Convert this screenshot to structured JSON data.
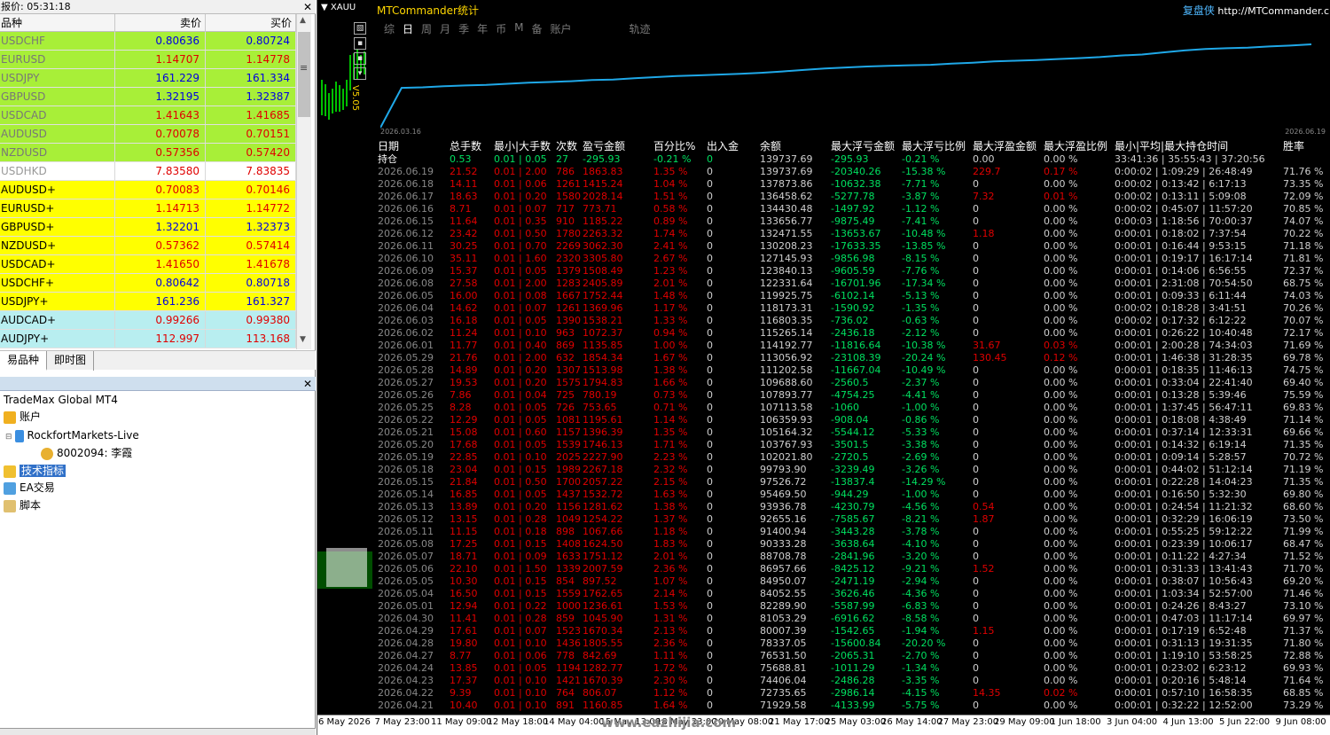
{
  "market_watch": {
    "title": "报价: 05:31:18",
    "headers": {
      "symbol": "品种",
      "bid": "卖价",
      "ask": "买价"
    },
    "rows": [
      {
        "symbol": "USDCHF",
        "bid": "0.80636",
        "ask": "0.80724",
        "bg": "#a8ef38",
        "sym_color": "#777777",
        "val_color": "#0000e0"
      },
      {
        "symbol": "EURUSD",
        "bid": "1.14707",
        "ask": "1.14778",
        "bg": "#a8ef38",
        "sym_color": "#777777",
        "val_color": "#e00000"
      },
      {
        "symbol": "USDJPY",
        "bid": "161.229",
        "ask": "161.334",
        "bg": "#a8ef38",
        "sym_color": "#777777",
        "val_color": "#0000e0"
      },
      {
        "symbol": "GBPUSD",
        "bid": "1.32195",
        "ask": "1.32387",
        "bg": "#a8ef38",
        "sym_color": "#777777",
        "val_color": "#0000e0"
      },
      {
        "symbol": "USDCAD",
        "bid": "1.41643",
        "ask": "1.41685",
        "bg": "#a8ef38",
        "sym_color": "#777777",
        "val_color": "#e00000"
      },
      {
        "symbol": "AUDUSD",
        "bid": "0.70078",
        "ask": "0.70151",
        "bg": "#a8ef38",
        "sym_color": "#777777",
        "val_color": "#e00000"
      },
      {
        "symbol": "NZDUSD",
        "bid": "0.57356",
        "ask": "0.57420",
        "bg": "#a8ef38",
        "sym_color": "#777777",
        "val_color": "#e00000"
      },
      {
        "symbol": "USDHKD",
        "bid": "7.83580",
        "ask": "7.83835",
        "bg": "#ffffff",
        "sym_color": "#999999",
        "val_color": "#e00000"
      },
      {
        "symbol": "AUDUSD+",
        "bid": "0.70083",
        "ask": "0.70146",
        "bg": "#ffff00",
        "sym_color": "#000000",
        "val_color": "#e00000"
      },
      {
        "symbol": "EURUSD+",
        "bid": "1.14713",
        "ask": "1.14772",
        "bg": "#ffff00",
        "sym_color": "#000000",
        "val_color": "#e00000"
      },
      {
        "symbol": "GBPUSD+",
        "bid": "1.32201",
        "ask": "1.32373",
        "bg": "#ffff00",
        "sym_color": "#000000",
        "val_color": "#0000e0"
      },
      {
        "symbol": "NZDUSD+",
        "bid": "0.57362",
        "ask": "0.57414",
        "bg": "#ffff00",
        "sym_color": "#000000",
        "val_color": "#e00000"
      },
      {
        "symbol": "USDCAD+",
        "bid": "1.41650",
        "ask": "1.41678",
        "bg": "#ffff00",
        "sym_color": "#000000",
        "val_color": "#e00000"
      },
      {
        "symbol": "USDCHF+",
        "bid": "0.80642",
        "ask": "0.80718",
        "bg": "#ffff00",
        "sym_color": "#000000",
        "val_color": "#0000e0"
      },
      {
        "symbol": "USDJPY+",
        "bid": "161.236",
        "ask": "161.327",
        "bg": "#ffff00",
        "sym_color": "#000000",
        "val_color": "#0000e0"
      },
      {
        "symbol": "AUDCAD+",
        "bid": "0.99266",
        "ask": "0.99380",
        "bg": "#b8eef0",
        "sym_color": "#000000",
        "val_color": "#e00000"
      },
      {
        "symbol": "AUDJPY+",
        "bid": "112.997",
        "ask": "113.168",
        "bg": "#b8eef0",
        "sym_color": "#000000",
        "val_color": "#e00000"
      }
    ],
    "tabs": [
      "易品种",
      "即时图"
    ]
  },
  "navigator": {
    "title": "",
    "broker": "TradeMax Global MT4",
    "accounts_label": "账户",
    "server": "RockfortMarkets-Live",
    "account": "8002094: 李霞",
    "indicators_label": "技术指标",
    "ea_label": "EA交易",
    "scripts_label": "脚本"
  },
  "chart": {
    "symbol": "XAUU",
    "side_label": "V5.05",
    "watermark": "www.eazhijia.com",
    "axis_ticks": [
      "6 May 2026",
      "7 May 23:00",
      "11 May 09:00",
      "12 May 18:00",
      "14 May 04:00",
      "15 May 13:00",
      "18 May 23:00",
      "20 May 08:00",
      "21 May 17:00",
      "25 May 03:00",
      "26 May 14:00",
      "27 May 23:00",
      "29 May 09:00",
      "1 Jun 18:00",
      "3 Jun 04:00",
      "4 Jun 13:00",
      "5 Jun 22:00",
      "9 Jun 08:00"
    ]
  },
  "panel": {
    "title": "MTCommander统计",
    "brand_cn": "复盘侠",
    "brand_url": "http://MTCommander.c",
    "tabs": [
      "综",
      "日",
      "周",
      "月",
      "季",
      "年",
      "币",
      "M",
      "备",
      "账户",
      "轨迹"
    ],
    "selected_tab": "日",
    "curve_start": "2026.03.16",
    "curve_end": "2026.06.19",
    "columns": [
      "日期",
      "总手数",
      "最小|大手数",
      "次数",
      "盈亏金额",
      "百分比%",
      "出入金",
      "余额",
      "最大浮亏金额",
      "最大浮亏比例",
      "最大浮盈金额",
      "最大浮盈比例",
      "最小|平均|最大持仓时间",
      "胜率"
    ],
    "holding_row": [
      "持仓",
      "0.53",
      "0.01 | 0.05",
      "27",
      "-295.93",
      "-0.21 %",
      "0",
      "139737.69",
      "-295.93",
      "-0.21 %",
      "0.00",
      "0.00 %",
      "33:41:36 | 35:55:43 | 37:20:56",
      ""
    ],
    "rows": [
      [
        "2026.06.19",
        "21.52",
        "0.01 | 2.00",
        "786",
        "1863.83",
        "1.35 %",
        "0",
        "139737.69",
        "-20340.26",
        "-15.38 %",
        "229.7",
        "0.17 %",
        "0:00:02 | 1:09:29 | 26:48:49",
        "71.76 %"
      ],
      [
        "2026.06.18",
        "14.11",
        "0.01 | 0.06",
        "1261",
        "1415.24",
        "1.04 %",
        "0",
        "137873.86",
        "-10632.38",
        "-7.71 %",
        "0",
        "0.00 %",
        "0:00:02 | 0:13:42 | 6:17:13",
        "73.35 %"
      ],
      [
        "2026.06.17",
        "18.63",
        "0.01 | 0.20",
        "1580",
        "2028.14",
        "1.51 %",
        "0",
        "136458.62",
        "-5277.78",
        "-3.87 %",
        "7.32",
        "0.01 %",
        "0:00:02 | 0:13:11 | 5:09:08",
        "72.09 %"
      ],
      [
        "2026.06.16",
        "8.71",
        "0.01 | 0.07",
        "717",
        "773.71",
        "0.58 %",
        "0",
        "134430.48",
        "-1497.92",
        "-1.12 %",
        "0",
        "0.00 %",
        "0:00:02 | 0:45:07 | 11:57:20",
        "70.85 %"
      ],
      [
        "2026.06.15",
        "11.64",
        "0.01 | 0.35",
        "910",
        "1185.22",
        "0.89 %",
        "0",
        "133656.77",
        "-9875.49",
        "-7.41 %",
        "0",
        "0.00 %",
        "0:00:03 | 1:18:56 | 70:00:37",
        "74.07 %"
      ],
      [
        "2026.06.12",
        "23.42",
        "0.01 | 0.50",
        "1780",
        "2263.32",
        "1.74 %",
        "0",
        "132471.55",
        "-13653.67",
        "-10.48 %",
        "1.18",
        "0.00 %",
        "0:00:01 | 0:18:02 | 7:37:54",
        "70.22 %"
      ],
      [
        "2026.06.11",
        "30.25",
        "0.01 | 0.70",
        "2269",
        "3062.30",
        "2.41 %",
        "0",
        "130208.23",
        "-17633.35",
        "-13.85 %",
        "0",
        "0.00 %",
        "0:00:01 | 0:16:44 | 9:53:15",
        "71.18 %"
      ],
      [
        "2026.06.10",
        "35.11",
        "0.01 | 1.60",
        "2320",
        "3305.80",
        "2.67 %",
        "0",
        "127145.93",
        "-9856.98",
        "-8.15 %",
        "0",
        "0.00 %",
        "0:00:01 | 0:19:17 | 16:17:14",
        "71.81 %"
      ],
      [
        "2026.06.09",
        "15.37",
        "0.01 | 0.05",
        "1379",
        "1508.49",
        "1.23 %",
        "0",
        "123840.13",
        "-9605.59",
        "-7.76 %",
        "0",
        "0.00 %",
        "0:00:01 | 0:14:06 | 6:56:55",
        "72.37 %"
      ],
      [
        "2026.06.08",
        "27.58",
        "0.01 | 2.00",
        "1283",
        "2405.89",
        "2.01 %",
        "0",
        "122331.64",
        "-16701.96",
        "-17.34 %",
        "0",
        "0.00 %",
        "0:00:01 | 2:31:08 | 70:54:50",
        "68.75 %"
      ],
      [
        "2026.06.05",
        "16.00",
        "0.01 | 0.08",
        "1667",
        "1752.44",
        "1.48 %",
        "0",
        "119925.75",
        "-6102.14",
        "-5.13 %",
        "0",
        "0.00 %",
        "0:00:01 | 0:09:33 | 6:11:44",
        "74.03 %"
      ],
      [
        "2026.06.04",
        "14.62",
        "0.01 | 0.07",
        "1261",
        "1369.96",
        "1.17 %",
        "0",
        "118173.31",
        "-1590.92",
        "-1.35 %",
        "0",
        "0.00 %",
        "0:00:02 | 0:18:28 | 3:41:51",
        "70.26 %"
      ],
      [
        "2026.06.03",
        "16.18",
        "0.01 | 0.05",
        "1390",
        "1538.21",
        "1.33 %",
        "0",
        "116803.35",
        "-736.02",
        "-0.63 %",
        "0",
        "0.00 %",
        "0:00:02 | 0:17:32 | 6:12:22",
        "70.07 %"
      ],
      [
        "2026.06.02",
        "11.24",
        "0.01 | 0.10",
        "963",
        "1072.37",
        "0.94 %",
        "0",
        "115265.14",
        "-2436.18",
        "-2.12 %",
        "0",
        "0.00 %",
        "0:00:01 | 0:26:22 | 10:40:48",
        "72.17 %"
      ],
      [
        "2026.06.01",
        "11.77",
        "0.01 | 0.40",
        "869",
        "1135.85",
        "1.00 %",
        "0",
        "114192.77",
        "-11816.64",
        "-10.38 %",
        "31.67",
        "0.03 %",
        "0:00:01 | 2:00:28 | 74:34:03",
        "71.69 %"
      ],
      [
        "2026.05.29",
        "21.76",
        "0.01 | 2.00",
        "632",
        "1854.34",
        "1.67 %",
        "0",
        "113056.92",
        "-23108.39",
        "-20.24 %",
        "130.45",
        "0.12 %",
        "0:00:01 | 1:46:38 | 31:28:35",
        "69.78 %"
      ],
      [
        "2026.05.28",
        "14.89",
        "0.01 | 0.20",
        "1307",
        "1513.98",
        "1.38 %",
        "0",
        "111202.58",
        "-11667.04",
        "-10.49 %",
        "0",
        "0.00 %",
        "0:00:01 | 0:18:35 | 11:46:13",
        "74.75 %"
      ],
      [
        "2026.05.27",
        "19.53",
        "0.01 | 0.20",
        "1575",
        "1794.83",
        "1.66 %",
        "0",
        "109688.60",
        "-2560.5",
        "-2.37 %",
        "0",
        "0.00 %",
        "0:00:01 | 0:33:04 | 22:41:40",
        "69.40 %"
      ],
      [
        "2026.05.26",
        "7.86",
        "0.01 | 0.04",
        "725",
        "780.19",
        "0.73 %",
        "0",
        "107893.77",
        "-4754.25",
        "-4.41 %",
        "0",
        "0.00 %",
        "0:00:01 | 0:13:28 | 5:39:46",
        "75.59 %"
      ],
      [
        "2026.05.25",
        "8.28",
        "0.01 | 0.05",
        "726",
        "753.65",
        "0.71 %",
        "0",
        "107113.58",
        "-1060",
        "-1.00 %",
        "0",
        "0.00 %",
        "0:00:01 | 1:37:45 | 56:47:11",
        "69.83 %"
      ],
      [
        "2026.05.22",
        "12.29",
        "0.01 | 0.05",
        "1081",
        "1195.61",
        "1.14 %",
        "0",
        "106359.93",
        "-908.04",
        "-0.86 %",
        "0",
        "0.00 %",
        "0:00:01 | 0:18:08 | 4:38:49",
        "71.14 %"
      ],
      [
        "2026.05.21",
        "15.08",
        "0.01 | 0.60",
        "1157",
        "1396.39",
        "1.35 %",
        "0",
        "105164.32",
        "-5544.12",
        "-5.33 %",
        "0",
        "0.00 %",
        "0:00:01 | 0:37:14 | 12:33:31",
        "69.66 %"
      ],
      [
        "2026.05.20",
        "17.68",
        "0.01 | 0.05",
        "1539",
        "1746.13",
        "1.71 %",
        "0",
        "103767.93",
        "-3501.5",
        "-3.38 %",
        "0",
        "0.00 %",
        "0:00:01 | 0:14:32 | 6:19:14",
        "71.35 %"
      ],
      [
        "2026.05.19",
        "22.85",
        "0.01 | 0.10",
        "2025",
        "2227.90",
        "2.23 %",
        "0",
        "102021.80",
        "-2720.5",
        "-2.69 %",
        "0",
        "0.00 %",
        "0:00:01 | 0:09:14 | 5:28:57",
        "70.72 %"
      ],
      [
        "2026.05.18",
        "23.04",
        "0.01 | 0.15",
        "1989",
        "2267.18",
        "2.32 %",
        "0",
        "99793.90",
        "-3239.49",
        "-3.26 %",
        "0",
        "0.00 %",
        "0:00:01 | 0:44:02 | 51:12:14",
        "71.19 %"
      ],
      [
        "2026.05.15",
        "21.84",
        "0.01 | 0.50",
        "1700",
        "2057.22",
        "2.15 %",
        "0",
        "97526.72",
        "-13837.4",
        "-14.29 %",
        "0",
        "0.00 %",
        "0:00:01 | 0:22:28 | 14:04:23",
        "71.35 %"
      ],
      [
        "2026.05.14",
        "16.85",
        "0.01 | 0.05",
        "1437",
        "1532.72",
        "1.63 %",
        "0",
        "95469.50",
        "-944.29",
        "-1.00 %",
        "0",
        "0.00 %",
        "0:00:01 | 0:16:50 | 5:32:30",
        "69.80 %"
      ],
      [
        "2026.05.13",
        "13.89",
        "0.01 | 0.20",
        "1156",
        "1281.62",
        "1.38 %",
        "0",
        "93936.78",
        "-4230.79",
        "-4.56 %",
        "0.54",
        "0.00 %",
        "0:00:01 | 0:24:54 | 11:21:32",
        "68.60 %"
      ],
      [
        "2026.05.12",
        "13.15",
        "0.01 | 0.28",
        "1049",
        "1254.22",
        "1.37 %",
        "0",
        "92655.16",
        "-7585.67",
        "-8.21 %",
        "1.87",
        "0.00 %",
        "0:00:01 | 0:32:29 | 16:06:19",
        "73.50 %"
      ],
      [
        "2026.05.11",
        "11.15",
        "0.01 | 0.18",
        "898",
        "1067.66",
        "1.18 %",
        "0",
        "91400.94",
        "-3443.28",
        "-3.78 %",
        "0",
        "0.00 %",
        "0:00:01 | 0:55:25 | 59:12:22",
        "71.99 %"
      ],
      [
        "2026.05.08",
        "17.25",
        "0.01 | 0.15",
        "1408",
        "1624.50",
        "1.83 %",
        "0",
        "90333.28",
        "-3638.64",
        "-4.10 %",
        "0",
        "0.00 %",
        "0:00:01 | 0:23:39 | 10:06:17",
        "68.47 %"
      ],
      [
        "2026.05.07",
        "18.71",
        "0.01 | 0.09",
        "1633",
        "1751.12",
        "2.01 %",
        "0",
        "88708.78",
        "-2841.96",
        "-3.20 %",
        "0",
        "0.00 %",
        "0:00:01 | 0:11:22 | 4:27:34",
        "71.52 %"
      ],
      [
        "2026.05.06",
        "22.10",
        "0.01 | 1.50",
        "1339",
        "2007.59",
        "2.36 %",
        "0",
        "86957.66",
        "-8425.12",
        "-9.21 %",
        "1.52",
        "0.00 %",
        "0:00:01 | 0:31:33 | 13:41:43",
        "71.70 %"
      ],
      [
        "2026.05.05",
        "10.30",
        "0.01 | 0.15",
        "854",
        "897.52",
        "1.07 %",
        "0",
        "84950.07",
        "-2471.19",
        "-2.94 %",
        "0",
        "0.00 %",
        "0:00:01 | 0:38:07 | 10:56:43",
        "69.20 %"
      ],
      [
        "2026.05.04",
        "16.50",
        "0.01 | 0.15",
        "1559",
        "1762.65",
        "2.14 %",
        "0",
        "84052.55",
        "-3626.46",
        "-4.36 %",
        "0",
        "0.00 %",
        "0:00:01 | 1:03:34 | 52:57:00",
        "71.46 %"
      ],
      [
        "2026.05.01",
        "12.94",
        "0.01 | 0.22",
        "1000",
        "1236.61",
        "1.53 %",
        "0",
        "82289.90",
        "-5587.99",
        "-6.83 %",
        "0",
        "0.00 %",
        "0:00:01 | 0:24:26 | 8:43:27",
        "73.10 %"
      ],
      [
        "2026.04.30",
        "11.41",
        "0.01 | 0.28",
        "859",
        "1045.90",
        "1.31 %",
        "0",
        "81053.29",
        "-6916.62",
        "-8.58 %",
        "0",
        "0.00 %",
        "0:00:01 | 0:47:03 | 11:17:14",
        "69.97 %"
      ],
      [
        "2026.04.29",
        "17.61",
        "0.01 | 0.07",
        "1523",
        "1670.34",
        "2.13 %",
        "0",
        "80007.39",
        "-1542.65",
        "-1.94 %",
        "1.15",
        "0.00 %",
        "0:00:01 | 0:17:19 | 6:52:48",
        "71.37 %"
      ],
      [
        "2026.04.28",
        "19.80",
        "0.01 | 0.10",
        "1436",
        "1805.55",
        "2.36 %",
        "0",
        "78337.05",
        "-15600.84",
        "-20.20 %",
        "0",
        "0.00 %",
        "0:00:01 | 0:31:13 | 19:31:35",
        "71.80 %"
      ],
      [
        "2026.04.27",
        "8.77",
        "0.01 | 0.06",
        "778",
        "842.69",
        "1.11 %",
        "0",
        "76531.50",
        "-2065.31",
        "-2.70 %",
        "0",
        "0.00 %",
        "0:00:01 | 1:19:10 | 53:58:25",
        "72.88 %"
      ],
      [
        "2026.04.24",
        "13.85",
        "0.01 | 0.05",
        "1194",
        "1282.77",
        "1.72 %",
        "0",
        "75688.81",
        "-1011.29",
        "-1.34 %",
        "0",
        "0.00 %",
        "0:00:01 | 0:23:02 | 6:23:12",
        "69.93 %"
      ],
      [
        "2026.04.23",
        "17.37",
        "0.01 | 0.10",
        "1421",
        "1670.39",
        "2.30 %",
        "0",
        "74406.04",
        "-2486.28",
        "-3.35 %",
        "0",
        "0.00 %",
        "0:00:01 | 0:20:16 | 5:48:14",
        "71.64 %"
      ],
      [
        "2026.04.22",
        "9.39",
        "0.01 | 0.10",
        "764",
        "806.07",
        "1.12 %",
        "0",
        "72735.65",
        "-2986.14",
        "-4.15 %",
        "14.35",
        "0.02 %",
        "0:00:01 | 0:57:10 | 16:58:35",
        "68.85 %"
      ],
      [
        "2026.04.21",
        "10.40",
        "0.01 | 0.10",
        "891",
        "1160.85",
        "1.64 %",
        "0",
        "71929.58",
        "-4133.99",
        "-5.75 %",
        "0",
        "0.00 %",
        "0:00:01 | 0:32:22 | 12:52:00",
        "73.29 %"
      ]
    ],
    "colors": {
      "header": "#ffffff",
      "holding": "#00e060",
      "date": "#888888",
      "profit": "#e00000",
      "neutral": "#cfcfcf",
      "loss": "#00e060",
      "curve": "#1fa8e8"
    }
  }
}
